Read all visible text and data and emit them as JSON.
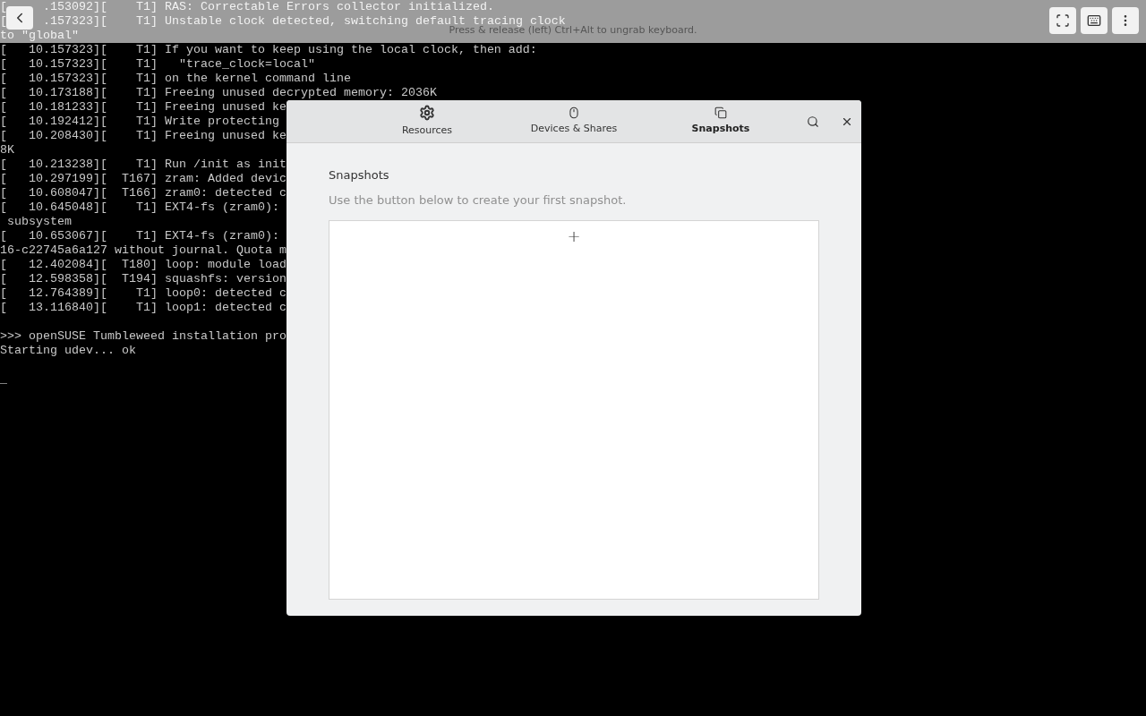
{
  "terminal": {
    "top_lines": [
      [
        "[",
        ".153092][    T1] RAS: Correctable Errors collector initialized."
      ],
      [
        "[",
        ".157323][    T1] Unstable clock detected, switching default tracing clock"
      ],
      [
        "to \"global\""
      ]
    ],
    "blocks": [
      [
        "[   10.157323][    T1] If you want to keep using the local clock, then add:",
        "[   10.157323][    T1]   \"trace_clock=local\"",
        "[   10.157323][    T1] on the kernel command line",
        "[   10.173188][    T1] Freeing unused decrypted memory: 2036K",
        "[   10.181233][    T1] Freeing unused ke",
        "[   10.192412][    T1] Write protecting",
        "[   10.208430][    T1] Freeing unused ke",
        "8K",
        "[   10.213238][    T1] Run /init as init",
        "[   10.297199][  T167] zram: Added devic",
        "[   10.608047][  T166] zram0: detected c",
        "[   10.645048][    T1] EXT4-fs (zram0):",
        " subsystem",
        "[   10.653067][    T1] EXT4-fs (zram0):",
        "16-c22745a6a127 without journal. Quota m",
        "[   12.402084][  T180] loop: module load",
        "[   12.598358][  T194] squashfs: version",
        "[   12.764389][    T1] loop0: detected c",
        "[   13.116840][    T1] loop1: detected c"
      ],
      [
        ">>> openSUSE Tumbleweed installation pro",
        "Starting udev... ok"
      ],
      [
        "_"
      ]
    ]
  },
  "top_bar": {
    "hint": "Press & release (left) Ctrl+Alt to ungrab keyboard."
  },
  "dialog": {
    "tabs": [
      {
        "label": "Resources",
        "selected": false
      },
      {
        "label": "Devices & Shares",
        "selected": false
      },
      {
        "label": "Snapshots",
        "selected": true
      }
    ],
    "heading": "Snapshots",
    "description": "Use the button below to create your first snapshot.",
    "add_button": "+"
  }
}
